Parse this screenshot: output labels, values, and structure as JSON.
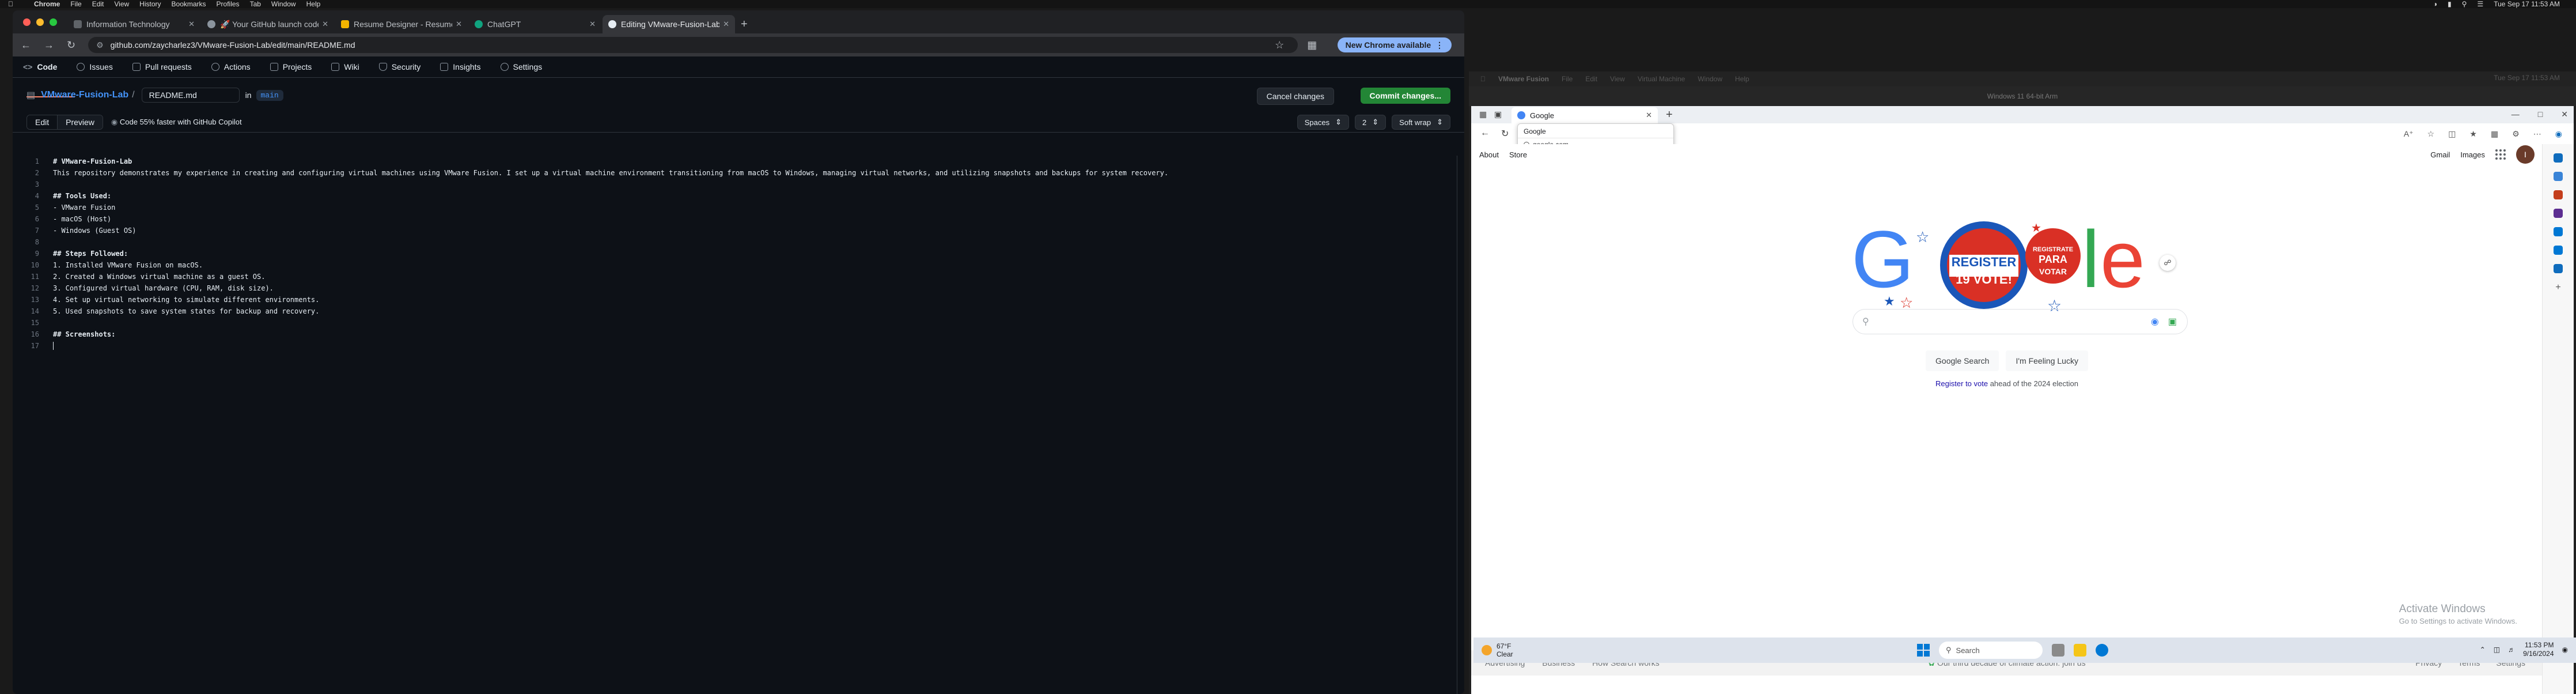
{
  "menubar": {
    "app": "Chrome",
    "items": [
      "File",
      "Edit",
      "View",
      "History",
      "Bookmarks",
      "Profiles",
      "Tab",
      "Window",
      "Help"
    ],
    "clock": "Tue Sep 17  11:53 AM"
  },
  "chrome": {
    "tabs": [
      {
        "title": "Information Technology",
        "color": "#5f6368"
      },
      {
        "title": "🚀 Your GitHub launch code",
        "color": "#8b949e"
      },
      {
        "title": "Resume Designer - Resume",
        "color": "#f4b400"
      },
      {
        "title": "ChatGPT",
        "color": "#10a37f"
      },
      {
        "title": "Editing VMware-Fusion-Lab/",
        "color": "#e6edf3"
      }
    ],
    "url": "github.com/zaycharlez3/VMware-Fusion-Lab/edit/main/README.md",
    "update_label": "New Chrome available"
  },
  "github": {
    "nav": [
      "Code",
      "Issues",
      "Pull requests",
      "Actions",
      "Projects",
      "Wiki",
      "Security",
      "Insights",
      "Settings"
    ],
    "repo": "VMware-Fusion-Lab",
    "filename": "README.md",
    "in_label": "in",
    "branch": "main",
    "cancel_label": "Cancel changes",
    "commit_label": "Commit changes...",
    "edit_tab": "Edit",
    "preview_tab": "Preview",
    "copilot": "Code 55% faster with GitHub Copilot",
    "indent_mode": "Spaces",
    "indent_size": "2",
    "wrap_mode": "Soft wrap",
    "lines": [
      "# VMware-Fusion-Lab",
      "This repository demonstrates my experience in creating and configuring virtual machines using VMware Fusion. I set up a virtual machine environment transitioning from macOS to Windows, managing virtual networks, and utilizing snapshots and backups for system recovery.",
      "",
      "## Tools Used:",
      "- VMware Fusion",
      "- macOS (Host)",
      "- Windows (Guest OS)",
      "",
      "## Steps Followed:",
      "1. Installed VMware Fusion on macOS.",
      "2. Created a Windows virtual machine as a guest OS.",
      "3. Configured virtual hardware (CPU, RAM, disk size).",
      "4. Set up virtual networking to simulate different environments.",
      "5. Used snapshots to save system states for backup and recovery.",
      "",
      "## Screenshots:",
      ""
    ]
  },
  "vmware": {
    "app": "VMware Fusion",
    "menu": [
      "File",
      "Edit",
      "View",
      "Virtual Machine",
      "Window",
      "Help"
    ],
    "clock": "Tue Sep 17  11:53 AM",
    "title": "Windows 11 64-bit Arm"
  },
  "edge": {
    "tab_title": "Google",
    "suggest_query": "Google",
    "suggest_url": "google.com",
    "links_left": [
      "About",
      "Store"
    ],
    "links_right": [
      "Gmail",
      "Images"
    ],
    "avatar": "I",
    "doodle": {
      "sign1": "REGISTER",
      "sign2": "19 VOTE!",
      "sign3": "REGISTRATE",
      "sign4": "PARA",
      "sign5": "VOTAR"
    },
    "btn_search": "Google Search",
    "btn_lucky": "I'm Feeling Lucky",
    "register_link": "Register to vote",
    "register_rest": " ahead of the 2024 election",
    "activate_title": "Activate Windows",
    "activate_sub": "Go to Settings to activate Windows.",
    "footer_left": [
      "Advertising",
      "Business",
      "How Search works"
    ],
    "footer_center": "Our third decade of climate action: join us",
    "footer_right": [
      "Privacy",
      "Terms",
      "Settings"
    ]
  },
  "taskbar": {
    "temp": "67°F",
    "condition": "Clear",
    "search": "Search",
    "time": "11:53 PM",
    "date": "9/16/2024"
  }
}
